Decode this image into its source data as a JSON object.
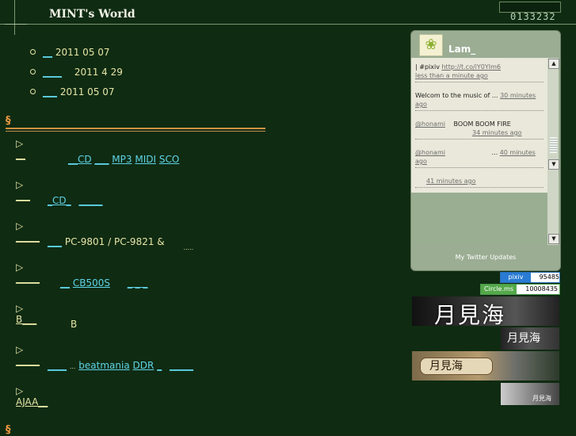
{
  "header": {
    "site_title": "MINT's World",
    "counter": "0133232"
  },
  "news": [
    {
      "link": "__",
      "text": "2011 05 07"
    },
    {
      "link": "____",
      "text": "2011 4 29"
    },
    {
      "link": "___",
      "text": "2011 05 07"
    }
  ],
  "section_mark": "§",
  "menu": [
    {
      "tri": "▷",
      "label": "__"
    },
    {
      "tri": "▷",
      "label": "___"
    },
    {
      "tri": "▷",
      "label": "_____"
    },
    {
      "tri": "▷",
      "label": "_____"
    },
    {
      "tri": "▷",
      "label": "B___"
    },
    {
      "tri": "▷",
      "label": "_____"
    },
    {
      "tri": "▷",
      "label": "AJAA__"
    }
  ],
  "sub": {
    "row1": {
      "a": "__CD",
      "b": "___",
      "c": "MP3",
      "d": "MIDI",
      "e": "SCO"
    },
    "row2": {
      "a": "_CD_",
      "b": "_____"
    },
    "row3": {
      "a": "___",
      "text": "PC-9801 / PC-9821 &",
      "dots": "....."
    },
    "row4": {
      "a": "__",
      "b": "CB500S",
      "c": "_ _ _"
    },
    "row5": {
      "text": "B"
    },
    "row6": {
      "a": "____",
      "dots": "...",
      "b": "beatmania",
      "c": "DDR",
      "d": "_",
      "e": "_____"
    }
  },
  "twitter": {
    "name": "Lam_",
    "avatar_icon": "leaf-icon",
    "tweets": [
      {
        "text": "|     #pixiv",
        "link": "http://t.co/iY0YIm6",
        "time": "less than a minute ago"
      },
      {
        "text": "Welcom to the music of ...",
        "time": "30 minutes ago"
      },
      {
        "mention": "@honami",
        "text": "BOOM BOOM FIRE",
        "time": "34 minutes ago"
      },
      {
        "mention": "@honami",
        "text": "...",
        "time": "40 minutes ago"
      },
      {
        "time": "41 minutes ago"
      }
    ],
    "footer": "My Twitter Updates"
  },
  "badges": {
    "pixiv_label": "pixiv",
    "pixiv_value": "95485",
    "circlems_label": "Circle.ms",
    "circlems_value": "10008435"
  },
  "banners": [
    "月見海",
    "月見海",
    "月見海",
    "月見海"
  ],
  "colors": {
    "background": "#0f2b12",
    "text": "#e6e6a6",
    "link": "#5fd3e6",
    "section": "#f09a40"
  }
}
